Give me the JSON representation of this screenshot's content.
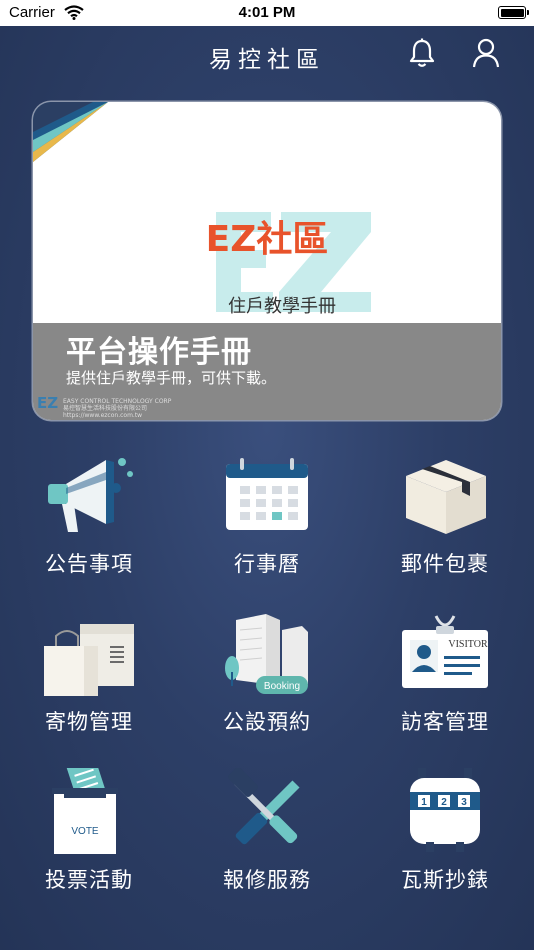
{
  "status_bar": {
    "carrier": "Carrier",
    "time": "4:01 PM"
  },
  "header": {
    "title": "易控社區",
    "icons": [
      "bell-icon",
      "user-icon"
    ]
  },
  "banner": {
    "logo_text": "EZ社區",
    "subtitle": "住戶教學手冊",
    "title": "平台操作手冊",
    "description": "提供住戶教學手冊，可供下載。",
    "company_line1": "EASY CONTROL TECHNOLOGY CORP",
    "company_line2": "易控智慧生活科技股份有限公司",
    "company_line3": "https://www.ezcon.com.tw"
  },
  "colors": {
    "accent_teal": "#6fc6c4",
    "accent_navy": "#1f5a8a",
    "brand_orange": "#e8532b",
    "background": "#2d3f67"
  },
  "menu": [
    {
      "label": "公告事項",
      "icon": "megaphone-icon"
    },
    {
      "label": "行事曆",
      "icon": "calendar-icon"
    },
    {
      "label": "郵件包裹",
      "icon": "package-icon"
    },
    {
      "label": "寄物管理",
      "icon": "storage-bags-icon"
    },
    {
      "label": "公設預約",
      "icon": "facility-booking-icon",
      "badge": "Booking"
    },
    {
      "label": "訪客管理",
      "icon": "visitor-badge-icon",
      "badge": "VISITOR"
    },
    {
      "label": "投票活動",
      "icon": "ballot-box-icon",
      "badge": "VOTE"
    },
    {
      "label": "報修服務",
      "icon": "repair-tools-icon"
    },
    {
      "label": "瓦斯抄錶",
      "icon": "gas-meter-icon",
      "meter": "1 2 3"
    }
  ]
}
